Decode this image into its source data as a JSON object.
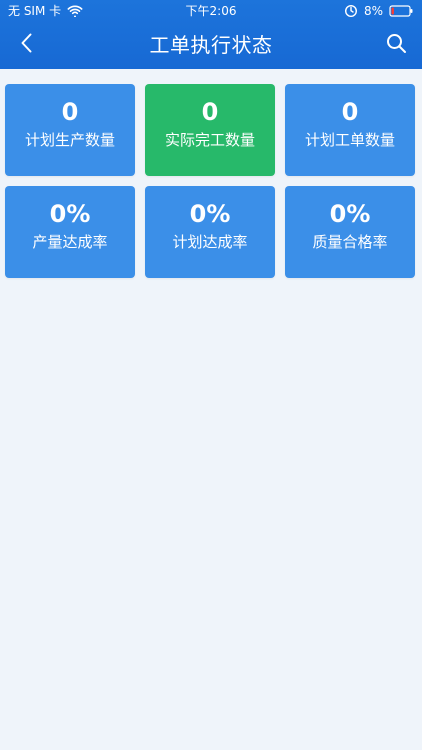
{
  "status_bar": {
    "carrier": "无 SIM 卡",
    "time": "下午2:06",
    "battery_percent": "8%"
  },
  "header": {
    "title": "工单执行状态"
  },
  "cards": [
    {
      "value": "0",
      "label": "计划生产数量",
      "accent": "#3b8fe8"
    },
    {
      "value": "0",
      "label": "实际完工数量",
      "accent": "#27b96a"
    },
    {
      "value": "0",
      "label": "计划工单数量",
      "accent": "#3b8fe8"
    },
    {
      "value": "0%",
      "label": "产量达成率",
      "accent": "#3b8fe8"
    },
    {
      "value": "0%",
      "label": "计划达成率",
      "accent": "#3b8fe8"
    },
    {
      "value": "0%",
      "label": "质量合格率",
      "accent": "#3b8fe8"
    }
  ],
  "icons": {
    "back": "chevron-left-icon",
    "search": "search-icon",
    "wifi": "wifi-icon",
    "battery": "battery-icon"
  },
  "colors": {
    "header": "#1d74db",
    "background": "#eff4fa"
  }
}
